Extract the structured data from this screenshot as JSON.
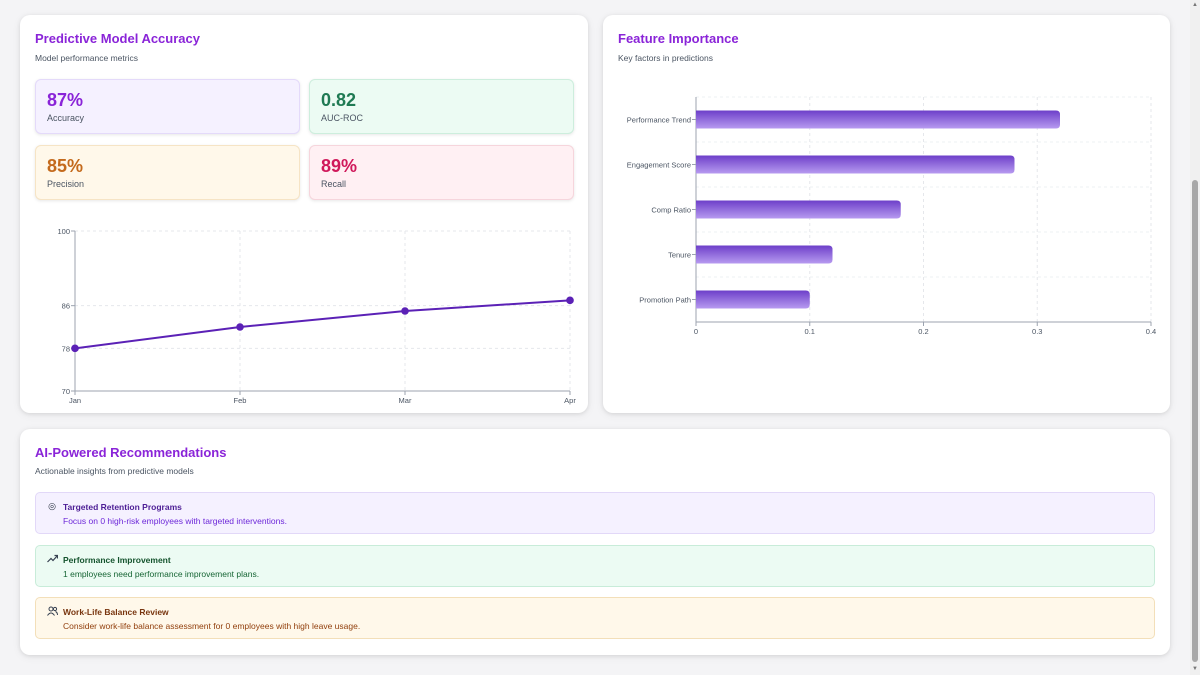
{
  "accuracy_card": {
    "title": "Predictive Model Accuracy",
    "subtitle": "Model performance metrics",
    "metrics": [
      {
        "value": "87%",
        "label": "Accuracy"
      },
      {
        "value": "0.82",
        "label": "AUC-ROC"
      },
      {
        "value": "85%",
        "label": "Precision"
      },
      {
        "value": "89%",
        "label": "Recall"
      }
    ]
  },
  "features_card": {
    "title": "Feature Importance",
    "subtitle": "Key factors in predictions"
  },
  "recommendations_card": {
    "title": "AI-Powered Recommendations",
    "subtitle": "Actionable insights from predictive models",
    "items": [
      {
        "icon": "target-icon",
        "title": "Targeted Retention Programs",
        "description": "Focus on 0 high-risk employees with targeted interventions."
      },
      {
        "icon": "trending-up-icon",
        "title": "Performance Improvement",
        "description": "1 employees need performance improvement plans."
      },
      {
        "icon": "users-icon",
        "title": "Work-Life Balance Review",
        "description": "Consider work-life balance assessment for 0 employees with high leave usage."
      }
    ]
  },
  "colors": {
    "accent": "#8a24d8",
    "line": "#5b21b6",
    "bar_top": "#6d3fc9",
    "bar_bottom": "#b79af0"
  },
  "chart_data": [
    {
      "type": "line",
      "x": [
        "Jan",
        "Feb",
        "Mar",
        "Apr"
      ],
      "y_ticks": [
        "100",
        "86",
        "78",
        "70"
      ],
      "ylim": [
        70,
        100
      ],
      "series": [
        {
          "values": [
            78,
            82,
            85,
            87
          ]
        }
      ],
      "grid": true
    },
    {
      "type": "bar",
      "orientation": "horizontal",
      "categories": [
        "Performance Trend",
        "Engagement Score",
        "Comp Ratio",
        "Tenure",
        "Promotion Path"
      ],
      "values": [
        0.32,
        0.28,
        0.18,
        0.12,
        0.1
      ],
      "x_ticks": [
        "0",
        "0.1",
        "0.2",
        "0.3",
        "0.4"
      ],
      "xlim": [
        0,
        0.4
      ],
      "grid": true
    }
  ]
}
